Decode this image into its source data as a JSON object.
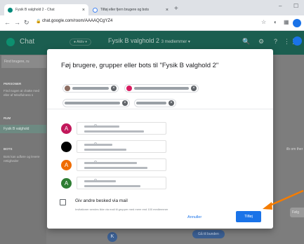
{
  "browser": {
    "tabs": [
      {
        "title": "Fysik B valghold 2 - Chat"
      },
      {
        "title": "Tilføj eller fjern brugere og bots"
      }
    ],
    "url": "chat.google.com/room/AAAAQCgYZ4"
  },
  "app": {
    "name": "Chat",
    "status": "● Aktiv ▾",
    "room_title": "Fysik B valghold 2",
    "room_members": "3 medlemmer ▾",
    "sidebar": {
      "search_placeholder": "Find brugere, ru",
      "people_label": "PERSONER",
      "people_text": "Find nogen at chatte med eller af Mindfulness s",
      "rooms_label": "RUM",
      "room_item": "Fysik B valghold",
      "bots_label": "BOTS",
      "bots_text": "Bots kan udføre og levere rettigheder"
    },
    "right_text": "ilb om ther",
    "right_button": "Følg",
    "bottom_pill": "Gå til bunden",
    "bottom_avatar": "K"
  },
  "dialog": {
    "title": "Føj brugere, grupper eller bots til \"Fysik B valghold 2\"",
    "suggestions": [
      {
        "initial": "A",
        "color": "#c2185b"
      },
      {
        "initial": "",
        "color": "#000000"
      },
      {
        "initial": "A",
        "color": "#ef6c00"
      },
      {
        "initial": "A",
        "color": "#2e7d32"
      }
    ],
    "email_checkbox_label": "Giv andre besked via mail",
    "email_checkbox_sub": "Invitationer sendes ikke via mail til grupper med mere end 100 medlemmer",
    "cancel_label": "Annuller",
    "add_label": "Tilføj"
  }
}
